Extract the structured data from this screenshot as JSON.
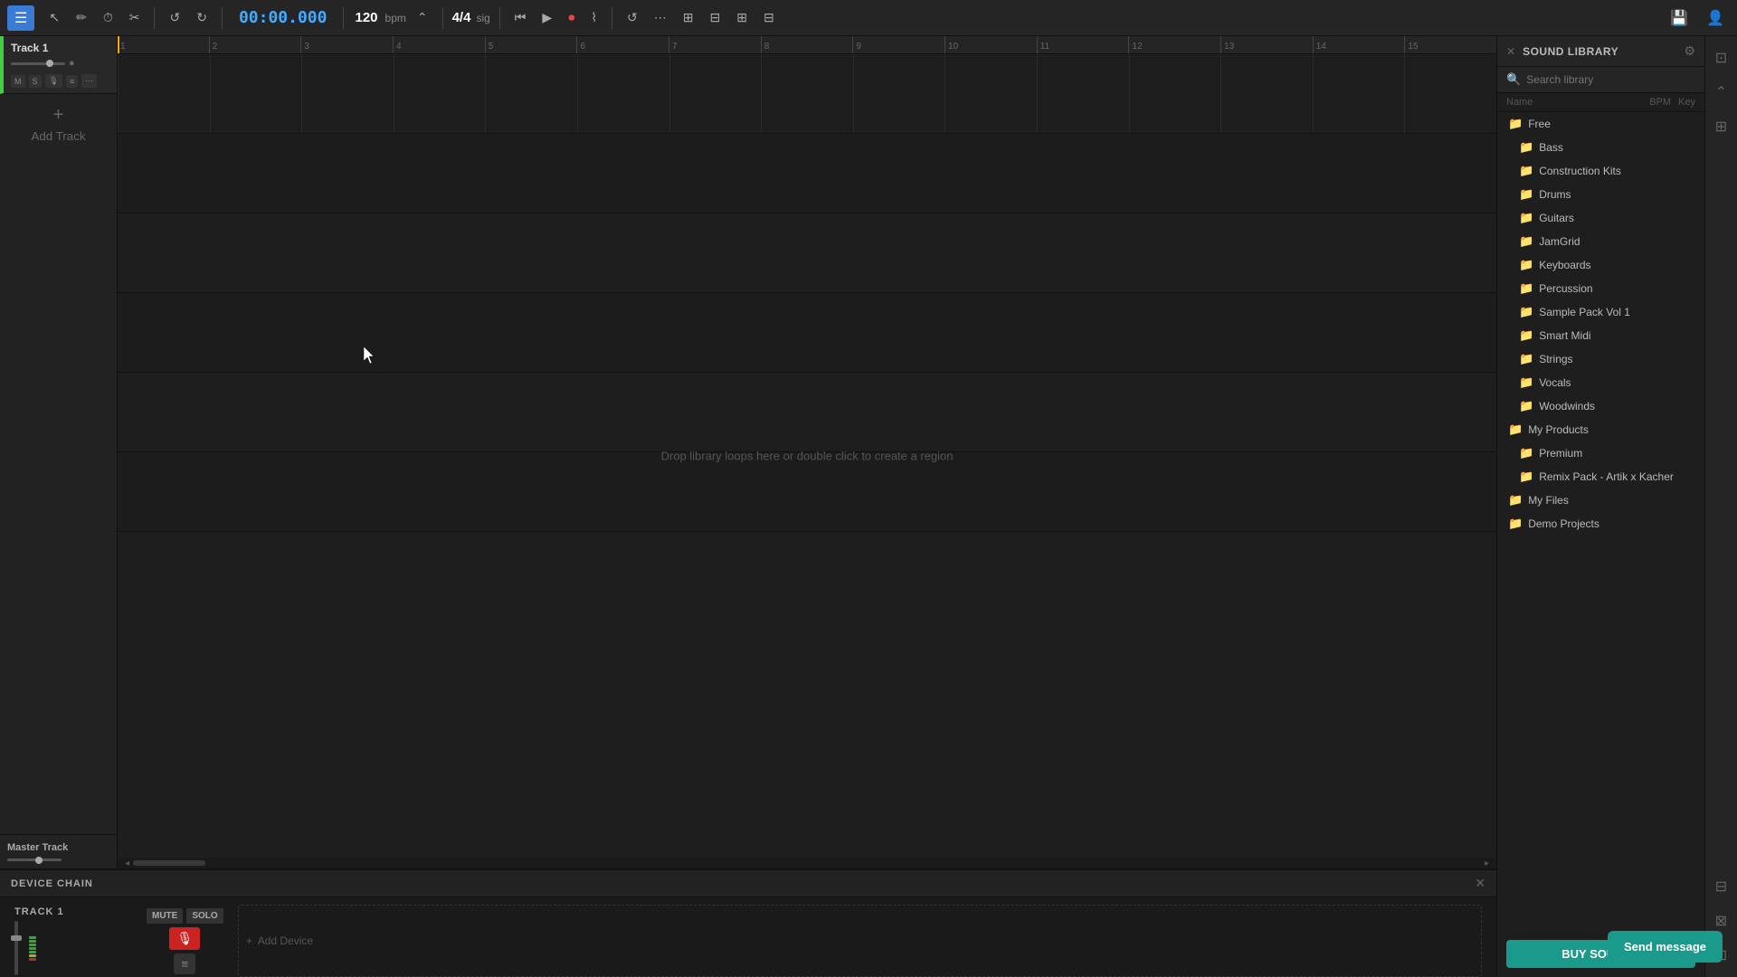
{
  "toolbar": {
    "hamburger_label": "☰",
    "time": "00:00.000",
    "bpm": "120",
    "bpm_label": "bpm",
    "bpm_arrows": "⌃",
    "sig": "4/4",
    "sig_label": "sig",
    "tools": [
      {
        "name": "pointer-tool",
        "icon": "↖",
        "tooltip": "Select"
      },
      {
        "name": "pencil-tool",
        "icon": "✏",
        "tooltip": "Draw"
      },
      {
        "name": "clock-tool",
        "icon": "⏱",
        "tooltip": "Tempo"
      },
      {
        "name": "scissors-tool",
        "icon": "✂",
        "tooltip": "Split"
      }
    ],
    "undo_label": "↺",
    "redo_label": "↻",
    "transport": [
      {
        "name": "rewind-btn",
        "icon": "⏮"
      },
      {
        "name": "play-btn",
        "icon": "▶"
      },
      {
        "name": "record-btn",
        "icon": "⏺"
      }
    ],
    "right_tools": [
      {
        "name": "loop-btn",
        "icon": "🔁"
      },
      {
        "name": "snap-btn",
        "icon": "⊞"
      },
      {
        "name": "merge-btn",
        "icon": "⊟"
      },
      {
        "name": "grid-btn",
        "icon": "⊞"
      },
      {
        "name": "mix-btn",
        "icon": "⊟"
      }
    ],
    "save_icon": "💾",
    "profile_icon": "👤"
  },
  "ruler": {
    "marks": [
      "1",
      "2",
      "3",
      "4",
      "5",
      "6",
      "7",
      "8",
      "9",
      "10",
      "11",
      "12",
      "13",
      "14",
      "15"
    ]
  },
  "tracks": [
    {
      "id": "track-1",
      "name": "Track 1",
      "selected": true,
      "color": "#44cc44",
      "volume": 75,
      "mute": "M",
      "solo": "S"
    }
  ],
  "add_track_label": "Add Track",
  "master_track_label": "Master Track",
  "arrangement_hint": "Drop library loops here or double click to create a region",
  "bottom_panel": {
    "title": "DEVICE CHAIN",
    "track_label": "TRACK 1",
    "close_icon": "✕",
    "mute_label": "MUTE",
    "solo_label": "SOLO",
    "add_device_label": "Add Device",
    "add_device_icon": "+"
  },
  "sound_library": {
    "title": "SOUND LIBRARY",
    "search_placeholder": "Search library",
    "cols": {
      "name": "Name",
      "bpm": "BPM",
      "key": "Key"
    },
    "items": [
      {
        "id": "free",
        "label": "Free",
        "indent": false
      },
      {
        "id": "bass",
        "label": "Bass",
        "indent": true
      },
      {
        "id": "construction-kits",
        "label": "Construction Kits",
        "indent": true
      },
      {
        "id": "drums",
        "label": "Drums",
        "indent": true
      },
      {
        "id": "guitars",
        "label": "Guitars",
        "indent": true
      },
      {
        "id": "jamgrid",
        "label": "JamGrid",
        "indent": true
      },
      {
        "id": "keyboards",
        "label": "Keyboards",
        "indent": true
      },
      {
        "id": "percussion",
        "label": "Percussion",
        "indent": true
      },
      {
        "id": "sample-pack-vol1",
        "label": "Sample Pack Vol 1",
        "indent": true
      },
      {
        "id": "smart-midi",
        "label": "Smart Midi",
        "indent": true
      },
      {
        "id": "strings",
        "label": "Strings",
        "indent": true
      },
      {
        "id": "vocals",
        "label": "Vocals",
        "indent": true
      },
      {
        "id": "woodwinds",
        "label": "Woodwinds",
        "indent": true
      },
      {
        "id": "my-products",
        "label": "My Products",
        "indent": false
      },
      {
        "id": "premium",
        "label": "Premium",
        "indent": true
      },
      {
        "id": "remix-pack",
        "label": "Remix Pack - Artik x Kacher",
        "indent": true
      },
      {
        "id": "my-files",
        "label": "My Files",
        "indent": false
      },
      {
        "id": "demo-projects",
        "label": "Demo Projects",
        "indent": false
      }
    ],
    "buy_sounds_label": "BUY SOUNDS"
  },
  "send_message_label": "Send message"
}
